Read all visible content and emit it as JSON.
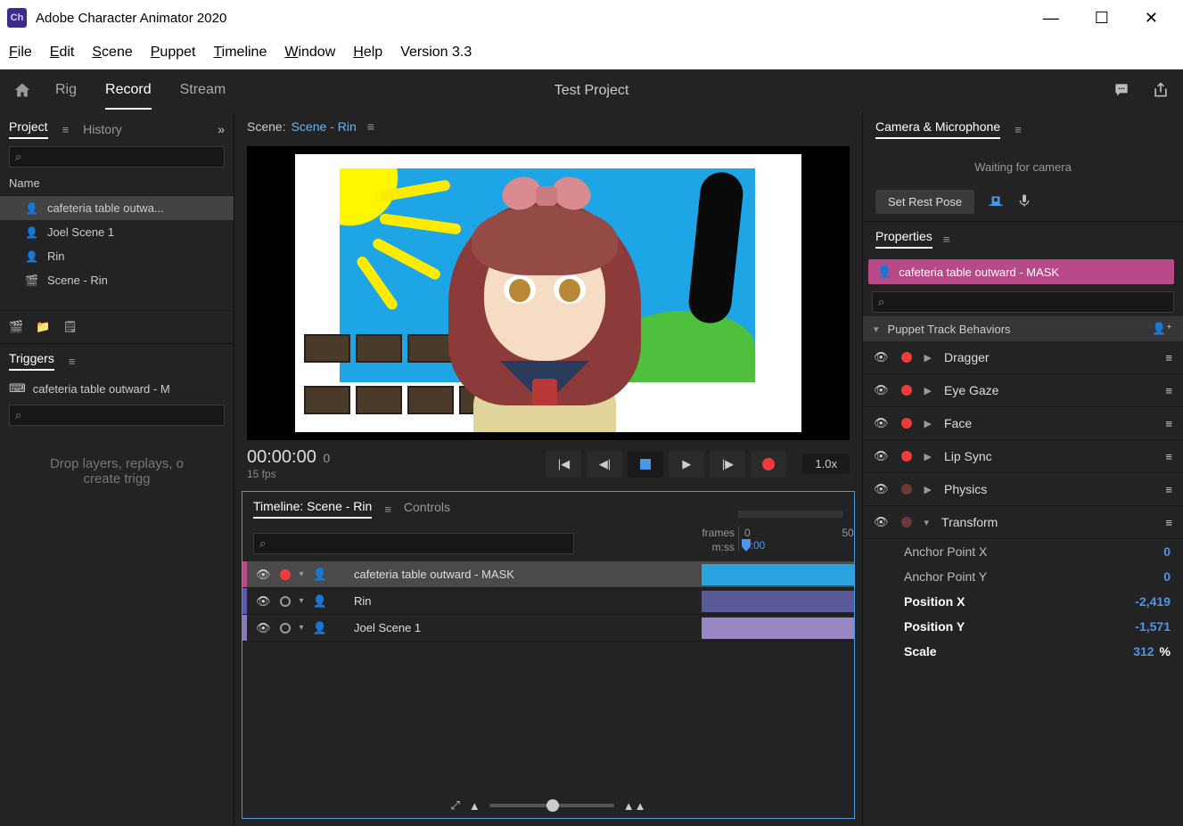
{
  "titlebar": {
    "app_name": "Adobe Character Animator 2020",
    "icon_text": "Ch"
  },
  "menubar": {
    "items": [
      "File",
      "Edit",
      "Scene",
      "Puppet",
      "Timeline",
      "Window",
      "Help"
    ],
    "version": "Version 3.3"
  },
  "topbar": {
    "tabs": [
      "Rig",
      "Record",
      "Stream"
    ],
    "active_tab": "Record",
    "project_title": "Test Project"
  },
  "project_panel": {
    "tabs": [
      "Project",
      "History"
    ],
    "active": "Project",
    "column_header": "Name",
    "items": [
      {
        "name": "cafeteria table outwa...",
        "type": "puppet",
        "selected": true
      },
      {
        "name": "Joel Scene 1",
        "type": "puppet",
        "selected": false
      },
      {
        "name": "Rin",
        "type": "puppet",
        "selected": false
      },
      {
        "name": "Scene - Rin",
        "type": "scene",
        "selected": false
      }
    ]
  },
  "triggers_panel": {
    "title": "Triggers",
    "selected": "cafeteria table outward - M",
    "drop_text": "Drop layers, replays, o\ncreate trigg"
  },
  "scene_panel": {
    "prefix": "Scene:",
    "name": "Scene - Rin"
  },
  "playbar": {
    "timecode": "00:00:00",
    "frame": "0",
    "fps": "15 fps",
    "speed": "1.0x"
  },
  "timeline": {
    "title": "Timeline: Scene - Rin",
    "other_tab": "Controls",
    "ruler": {
      "frames_label": "frames",
      "mss_label": "m:ss",
      "start": "0",
      "time_start": "0:00",
      "end": "50"
    },
    "tracks": [
      {
        "name": "cafeteria table outward - MASK",
        "color": "#b84a8a",
        "bar": "#2aa4e0",
        "selected": true,
        "rec": true
      },
      {
        "name": "Rin",
        "color": "#5a5aa8",
        "bar": "#5a5a9a",
        "selected": false,
        "rec": false
      },
      {
        "name": "Joel Scene 1",
        "color": "#8a7ab8",
        "bar": "#9a86c4",
        "selected": false,
        "rec": false
      }
    ]
  },
  "camera_panel": {
    "title": "Camera & Microphone",
    "waiting": "Waiting for camera",
    "rest_pose": "Set Rest Pose"
  },
  "properties_panel": {
    "title": "Properties",
    "selected_item": "cafeteria table outward - MASK",
    "behaviors_title": "Puppet Track Behaviors",
    "behaviors": [
      {
        "name": "Dragger",
        "rec": true,
        "expanded": false
      },
      {
        "name": "Eye Gaze",
        "rec": true,
        "expanded": false
      },
      {
        "name": "Face",
        "rec": true,
        "expanded": false
      },
      {
        "name": "Lip Sync",
        "rec": true,
        "expanded": false
      },
      {
        "name": "Physics",
        "rec": false,
        "expanded": false
      },
      {
        "name": "Transform",
        "rec": false,
        "expanded": true
      }
    ],
    "transform": [
      {
        "label": "Anchor Point X",
        "value": "0",
        "bold": false
      },
      {
        "label": "Anchor Point Y",
        "value": "0",
        "bold": false
      },
      {
        "label": "Position X",
        "value": "-2,419",
        "bold": true
      },
      {
        "label": "Position Y",
        "value": "-1,571",
        "bold": true
      },
      {
        "label": "Scale",
        "value": "312",
        "unit": "%",
        "bold": true
      }
    ]
  }
}
